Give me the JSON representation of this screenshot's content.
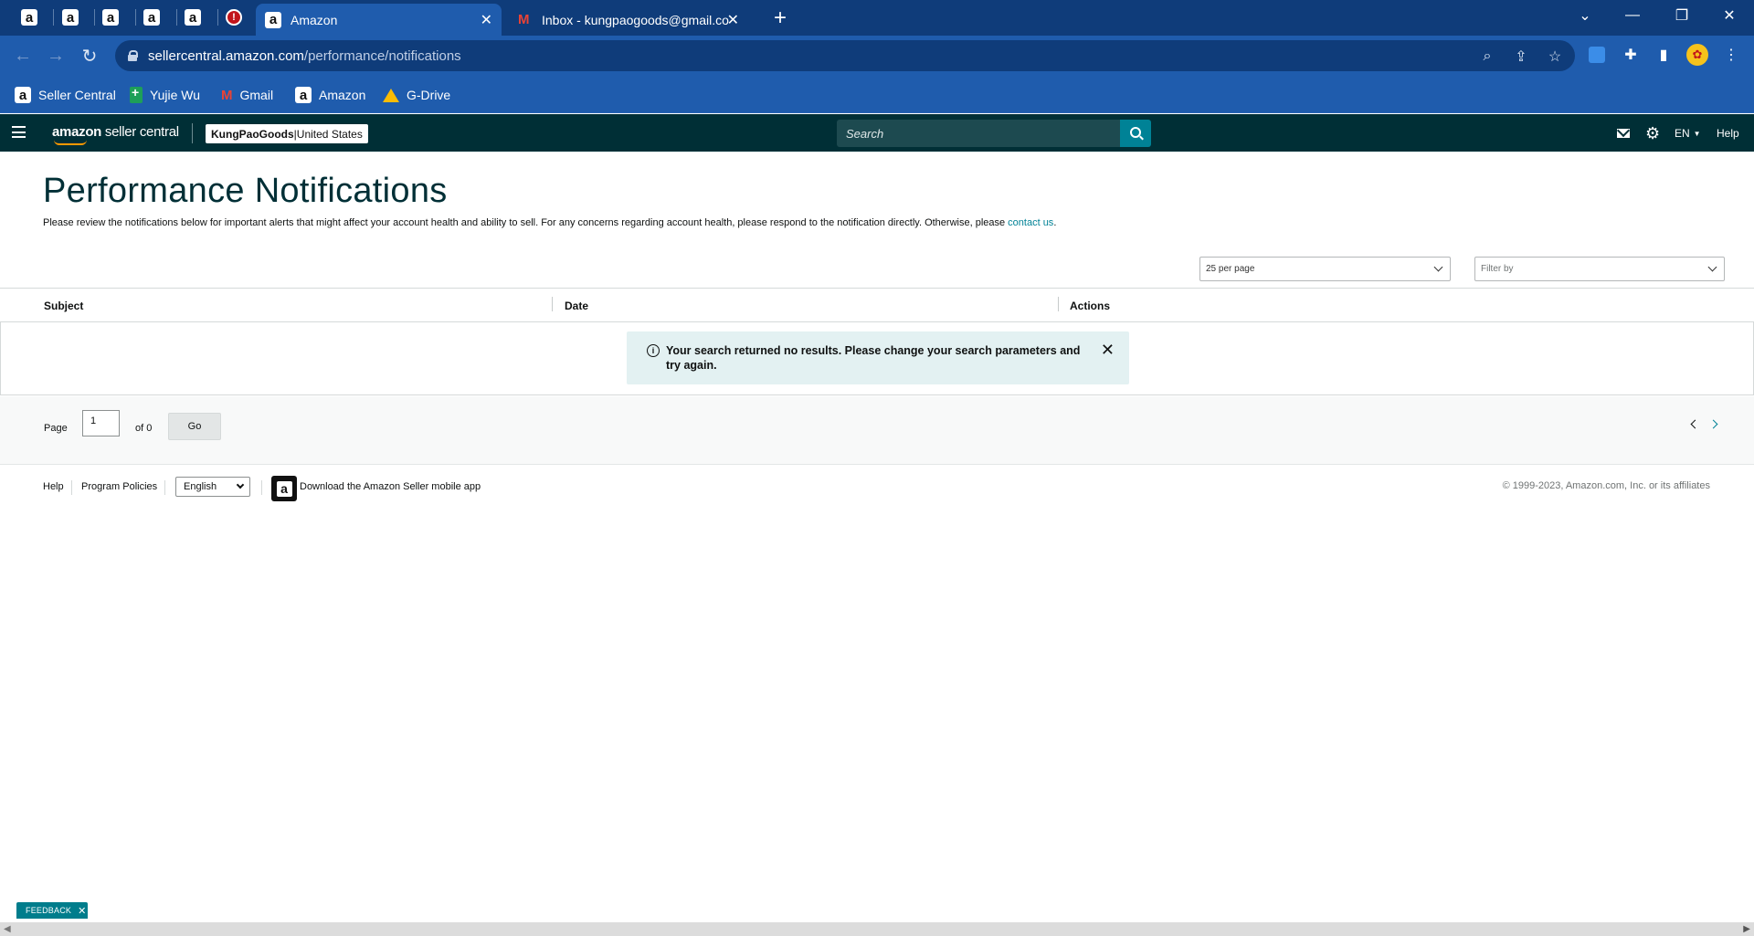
{
  "browser": {
    "mini_tabs": [
      {
        "icon": "amazon-favicon",
        "glyph": "a"
      },
      {
        "icon": "amazon-favicon",
        "glyph": "a"
      },
      {
        "icon": "amazon-favicon",
        "glyph": "a"
      },
      {
        "icon": "amazon-favicon",
        "glyph": "a"
      },
      {
        "icon": "amazon-favicon",
        "glyph": "a"
      },
      {
        "icon": "red-badge-favicon",
        "glyph": "!"
      }
    ],
    "active_tab": {
      "title": "Amazon",
      "icon": "amazon-favicon",
      "glyph": "a"
    },
    "second_tab": {
      "title": "Inbox - kungpaogoods@gmail.co",
      "icon": "gmail-icon"
    },
    "url_host": "sellercentral.amazon.com",
    "url_path": "/performance/notifications",
    "bookmarks": [
      {
        "label": "Seller Central",
        "icon": "amazon-favicon"
      },
      {
        "label": "Yujie Wu",
        "icon": "sheets-icon"
      },
      {
        "label": "Gmail",
        "icon": "gmail-icon"
      },
      {
        "label": "Amazon",
        "icon": "amazon-favicon"
      },
      {
        "label": "G-Drive",
        "icon": "drive-icon"
      }
    ]
  },
  "header": {
    "logo_bold": "amazon",
    "logo_rest": " seller central",
    "account_name": "KungPaoGoods",
    "account_sep": " | ",
    "marketplace": "United States",
    "search_placeholder": "Search",
    "language": "EN",
    "help": "Help"
  },
  "page": {
    "title": "Performance Notifications",
    "intro": "Please review the notifications below for important alerts that might affect your account health and ability to sell. For any concerns regarding account health, please respond to the notification directly. Otherwise, please ",
    "contact_link": "contact us",
    "intro_end": "."
  },
  "filters": {
    "per_page": "25 per page",
    "filter_placeholder": "Filter by"
  },
  "table": {
    "columns": [
      "Subject",
      "Date",
      "Actions"
    ],
    "empty_message": "Your search returned no results. Please change your search parameters and try again."
  },
  "pagination": {
    "page_label": "Page",
    "current_page": "1",
    "of_label": "of 0",
    "go_label": "Go"
  },
  "footer": {
    "help": "Help",
    "program_policies": "Program Policies",
    "language": "English",
    "app_download": "Download the Amazon Seller mobile app",
    "copyright": "© 1999-2023, Amazon.com, Inc. or its affiliates"
  },
  "feedback": {
    "label": "FEEDBACK"
  },
  "colors": {
    "browser_frame": "#0f3c7a",
    "browser_toolbar": "#1f5cad",
    "header_bg": "#002f36",
    "accent": "#008296",
    "alert_bg": "#e3f1f2"
  }
}
